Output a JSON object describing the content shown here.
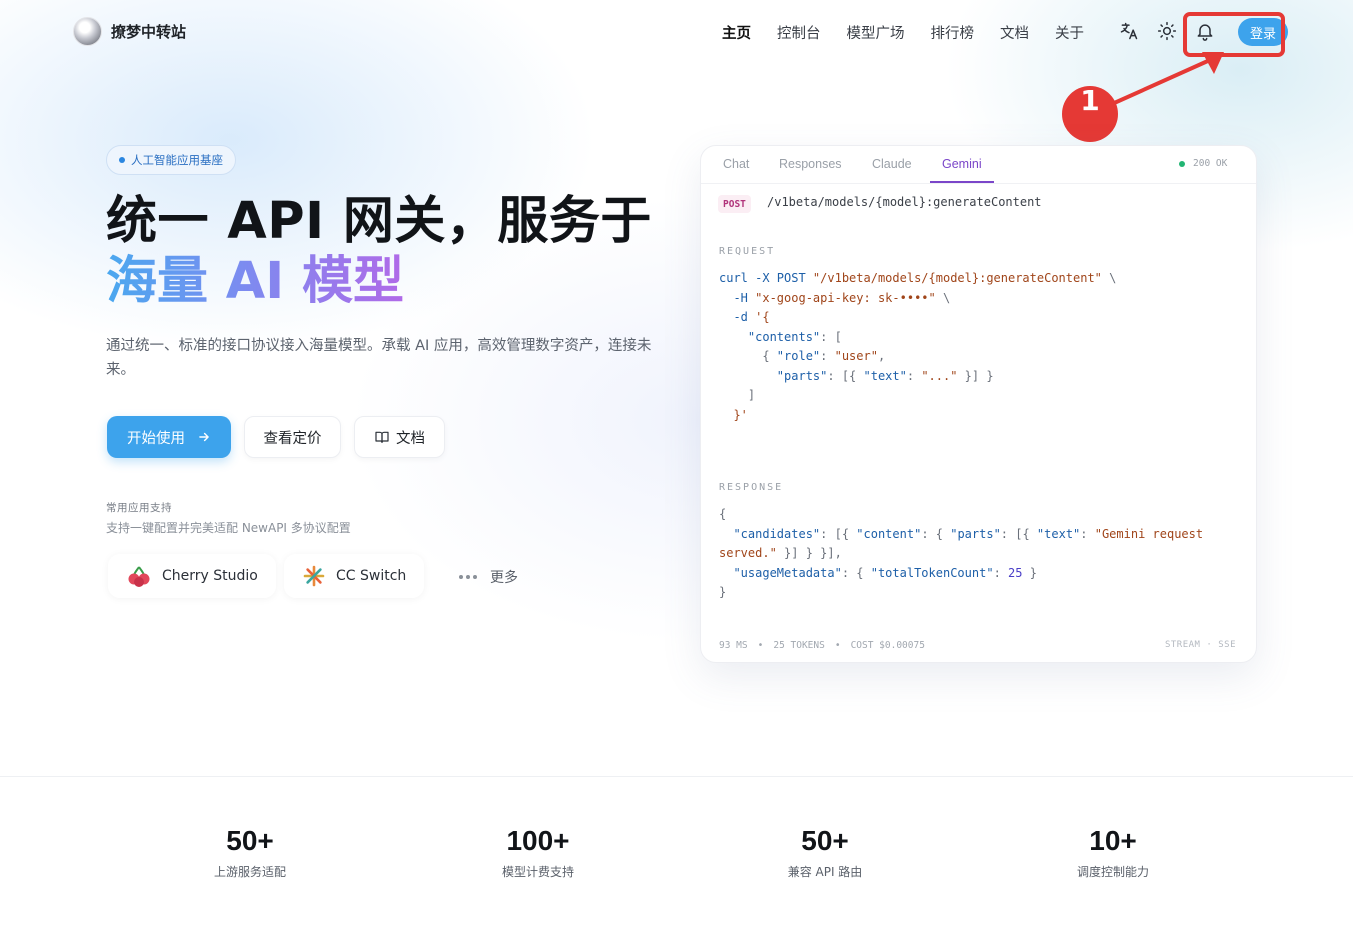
{
  "header": {
    "brand_name": "撩梦中转站",
    "nav": [
      "主页",
      "控制台",
      "模型广场",
      "排行榜",
      "文档",
      "关于"
    ],
    "login_label": "登录"
  },
  "annotation": {
    "step_number": "1"
  },
  "hero": {
    "badge": "人工智能应用基座",
    "headline_line1": "统一 API 网关，服务于",
    "headline_line2": "海量 AI 模型",
    "description": "通过统一、标准的接口协议接入海量模型。承载 AI 应用，高效管理数字资产，连接未来。",
    "primary_button": "开始使用",
    "pricing_button": "查看定价",
    "docs_button": "文档",
    "support_title": "常用应用支持",
    "support_subtitle": "支持一键配置并完美适配 NewAPI 多协议配置",
    "apps": [
      "Cherry Studio",
      "CC Switch"
    ],
    "more_label": "更多"
  },
  "code_card": {
    "tabs": [
      "Chat",
      "Responses",
      "Claude",
      "Gemini"
    ],
    "active_tab": "Gemini",
    "status": "200 OK",
    "method": "POST",
    "endpoint": "/v1beta/models/{model}:generateContent",
    "request_label": "REQUEST",
    "response_label": "RESPONSE",
    "metrics": [
      "93 MS",
      "25 TOKENS",
      "COST $0.00075"
    ],
    "stream_label": "STREAM · SSE"
  },
  "stats": [
    {
      "value": "50+",
      "label": "上游服务适配"
    },
    {
      "value": "100+",
      "label": "模型计费支持"
    },
    {
      "value": "50+",
      "label": "兼容 API 路由"
    },
    {
      "value": "10+",
      "label": "调度控制能力"
    }
  ],
  "colors": {
    "accent": "#3da3ec",
    "gemini_tab": "#7b46c9",
    "annotation_red": "#e53935",
    "status_green": "#22b573"
  },
  "icons": [
    "translate-icon",
    "sun-icon",
    "bell-icon",
    "arrow-right-icon",
    "book-icon",
    "cherry-studio-logo",
    "cc-switch-logo",
    "more-dots-icon"
  ]
}
